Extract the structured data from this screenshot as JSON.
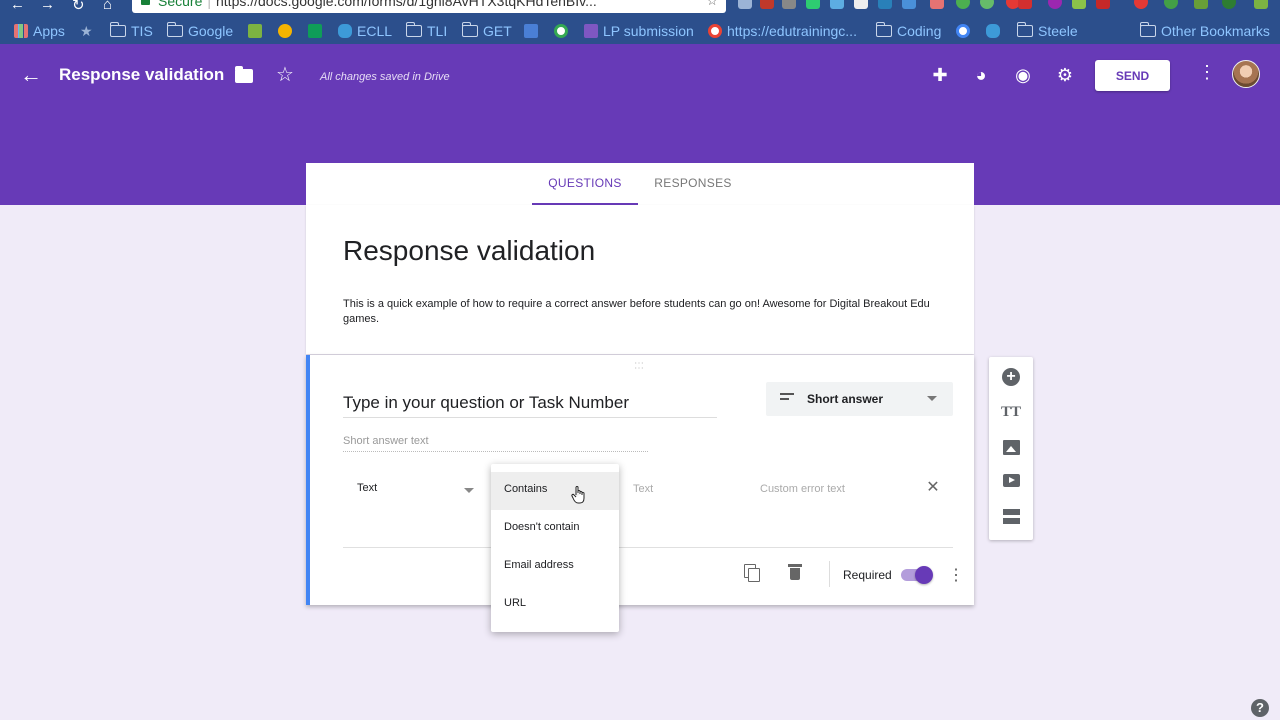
{
  "browser": {
    "security_label": "Secure",
    "url": "https://docs.google.com/forms/d/1gnl8AvHTX3tqKHdTenBIv...",
    "bookmarks": [
      {
        "label": "Apps"
      },
      {
        "label": "TIS"
      },
      {
        "label": "Google"
      },
      {
        "label": "ECLL"
      },
      {
        "label": "TLI"
      },
      {
        "label": "GET"
      },
      {
        "label": "LP submission"
      },
      {
        "label": "https://edutrainingc..."
      },
      {
        "label": "Coding"
      },
      {
        "label": "Steele"
      },
      {
        "label": "Other Bookmarks"
      }
    ]
  },
  "header": {
    "title": "Response validation",
    "save_status": "All changes saved in Drive",
    "send_label": "SEND",
    "accent": "#673ab7"
  },
  "tabs": {
    "questions": "QUESTIONS",
    "responses": "RESPONSES"
  },
  "form": {
    "title": "Response validation",
    "description": "This is a quick example of how to require a correct answer before students can go on! Awesome for Digital Breakout Edu games."
  },
  "question": {
    "title": "Type in your question or Task Number",
    "type": "Short answer",
    "answer_hint": "Short answer text",
    "validation": {
      "type": "Text",
      "text_placeholder": "Text",
      "error_placeholder": "Custom error text"
    },
    "required_label": "Required",
    "required": true
  },
  "menu": {
    "items": [
      {
        "label": "Contains",
        "active": true
      },
      {
        "label": "Doesn't contain"
      },
      {
        "label": "Email address"
      },
      {
        "label": "URL"
      }
    ]
  },
  "side_toolbar": {
    "title_glyph": "TT"
  },
  "help": "?"
}
